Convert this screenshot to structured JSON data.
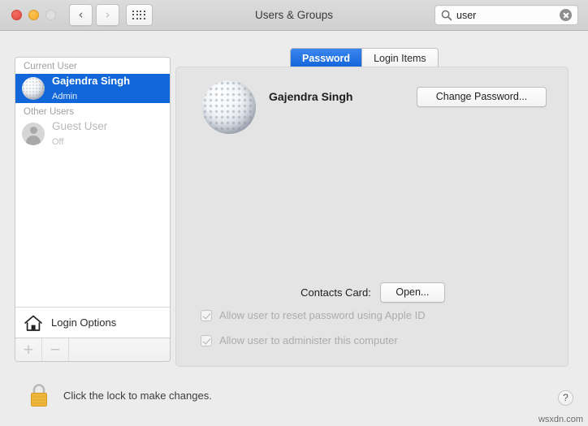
{
  "window": {
    "title": "Users & Groups",
    "traffic_lights": [
      "close",
      "minimize",
      "zoom-disabled"
    ],
    "nav": {
      "back_icon": "chevron-left",
      "forward_icon": "chevron-right",
      "grid_icon": "show-all-grid"
    }
  },
  "search": {
    "value": "user",
    "placeholder": "Search",
    "icon": "search-icon",
    "clear_icon": "clear-circle-icon"
  },
  "sidebar": {
    "groups": [
      {
        "header": "Current User",
        "users": [
          {
            "name": "Gajendra Singh",
            "role": "Admin",
            "avatar": "golf-ball-avatar",
            "selected": true
          }
        ]
      },
      {
        "header": "Other Users",
        "users": [
          {
            "name": "Guest User",
            "role": "Off",
            "avatar": "person-silhouette-avatar",
            "selected": false
          }
        ]
      }
    ],
    "login_options": {
      "label": "Login Options",
      "icon": "house-icon"
    },
    "footer": {
      "add_label": "+",
      "remove_label": "−"
    }
  },
  "tabs": [
    {
      "label": "Password",
      "active": true
    },
    {
      "label": "Login Items",
      "active": false
    }
  ],
  "main": {
    "avatar": "golf-ball-avatar",
    "full_name": "Gajendra Singh",
    "change_password_label": "Change Password...",
    "contacts_card_label": "Contacts Card:",
    "open_label": "Open...",
    "checkboxes": [
      {
        "label": "Allow user to reset password using Apple ID",
        "checked": true,
        "enabled": false
      },
      {
        "label": "Allow user to administer this computer",
        "checked": true,
        "enabled": false
      }
    ]
  },
  "footer": {
    "lock_icon": "locked-padlock-icon",
    "lock_text": "Click the lock to make changes.",
    "help_label": "?",
    "watermark": "wsxdn.com"
  },
  "colors": {
    "accent_blue": "#1166d9",
    "titlebar": "#d4d4d4",
    "window_bg": "#ececec",
    "panel_bg": "#e4e4e4",
    "lock_gold": "#f0b63c"
  }
}
